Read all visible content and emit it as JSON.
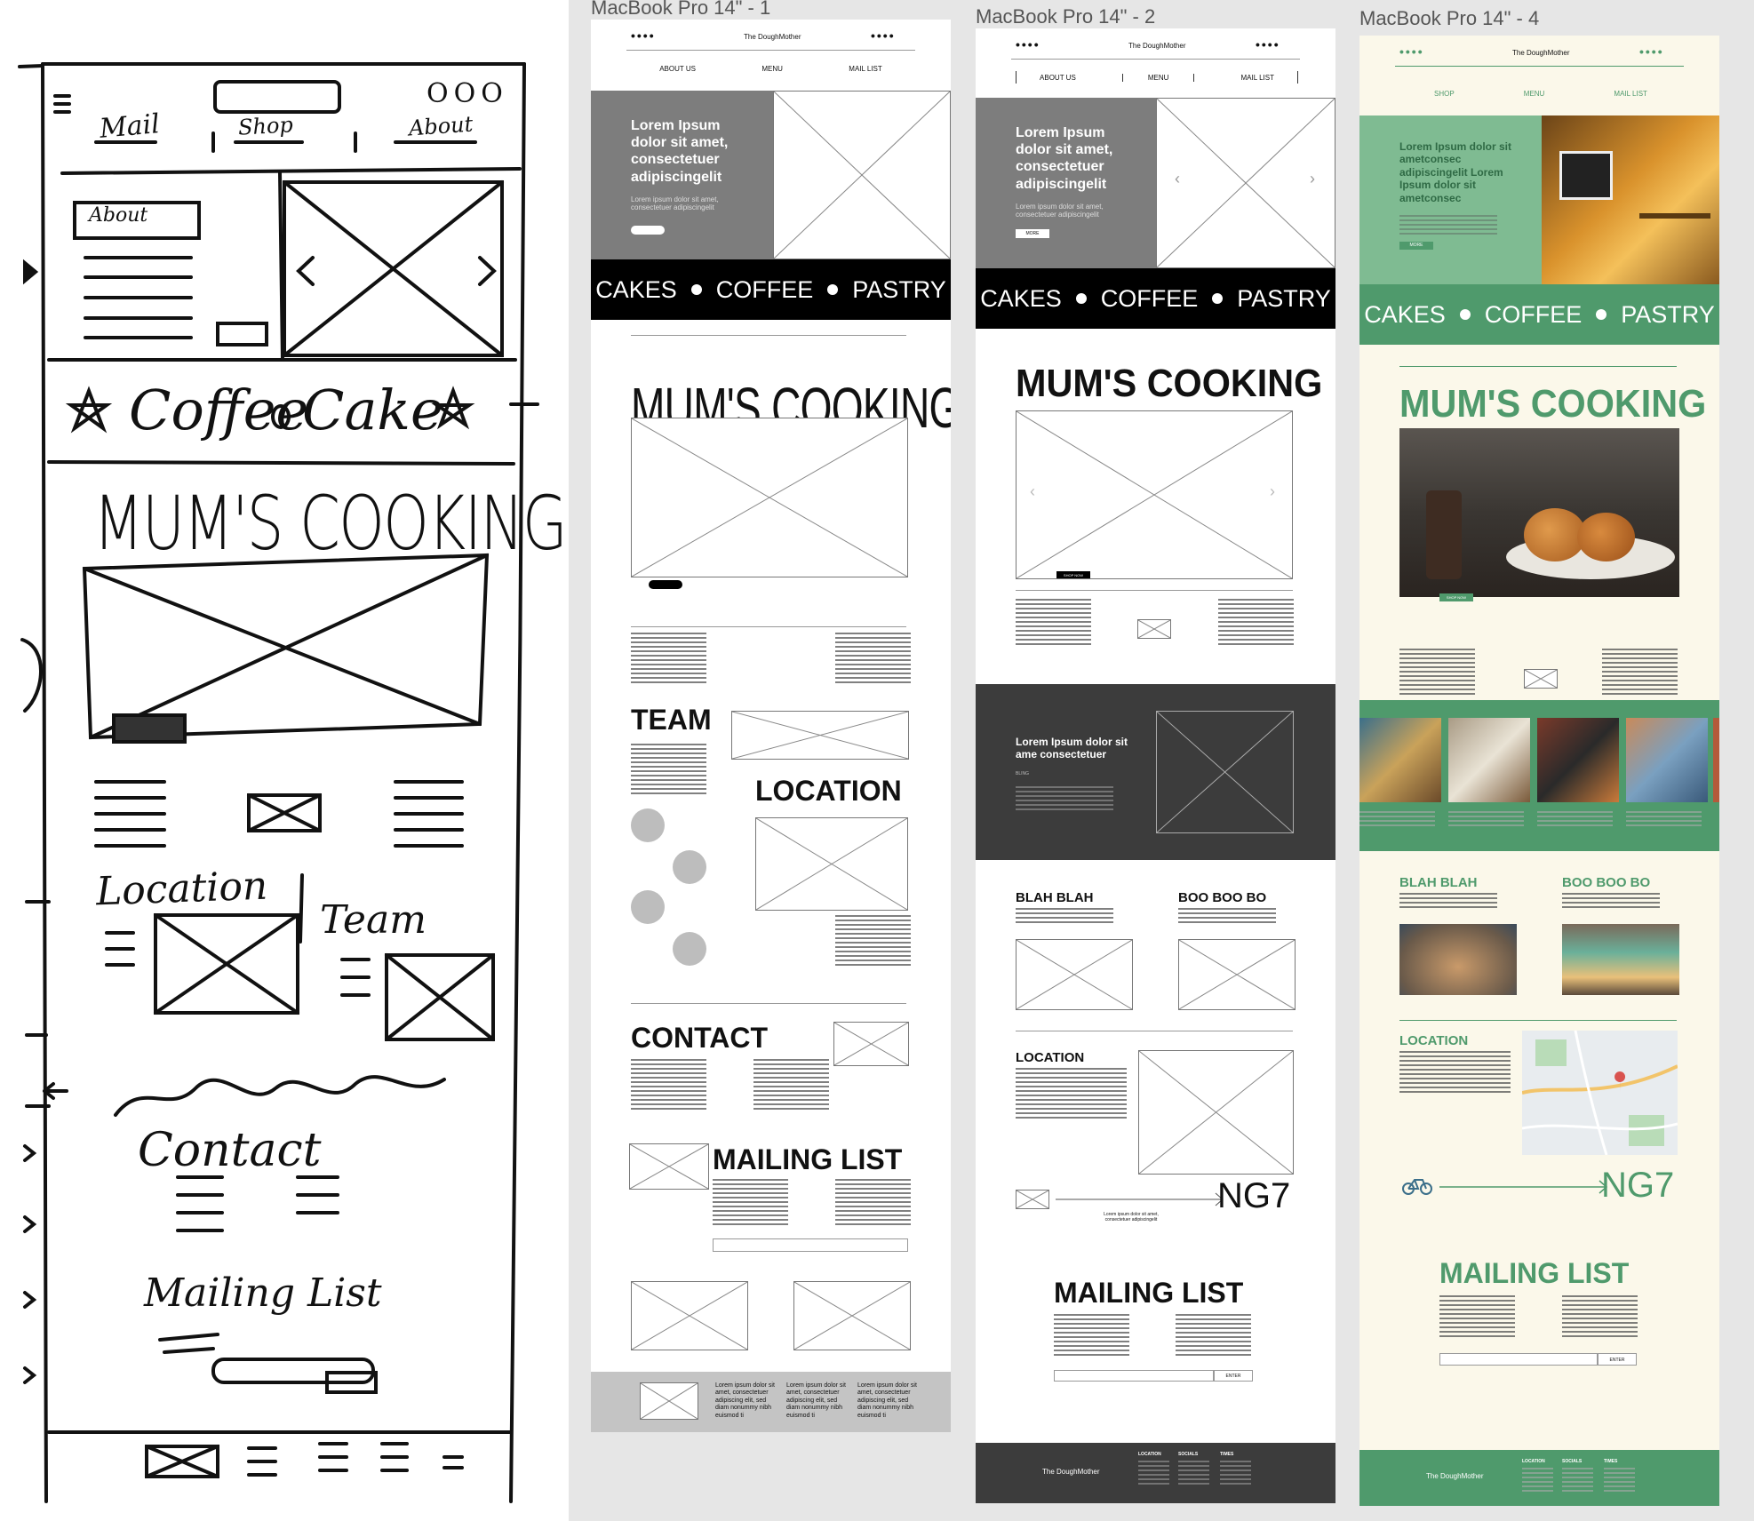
{
  "sketch": {
    "nav": [
      "Mail",
      "Shop",
      "About"
    ],
    "icons": "OOO",
    "about_box": "About",
    "strip": [
      "Coffee",
      "Cake"
    ],
    "heading": "MUM'S COOKING",
    "location": "Location",
    "team": "Team",
    "contact": "Contact",
    "mailing": "Mailing List"
  },
  "frames": {
    "frame1_label": "MacBook Pro 14\" - 1",
    "frame2_label": "MacBook Pro 14\" - 2",
    "frame4_label": "MacBook Pro 14\" - 4"
  },
  "wireframe1": {
    "dots": "••••",
    "brand": "The DoughMother",
    "nav": [
      "ABOUT US",
      "MENU",
      "MAIL LIST"
    ],
    "hero_title": "Lorem Ipsum dolor sit amet, consectetuer adipiscingelit",
    "hero_sub": "Lorem ipsum dolor sit amet, consectetuer adipiscingelit",
    "strip": [
      "CAKES",
      "COFFEE",
      "PASTRY"
    ],
    "heading": "MUM'S COOKING",
    "team": "TEAM",
    "location": "LOCATION",
    "contact": "CONTACT",
    "mailing": "MAILING LIST",
    "footer_text": "Lorem ipsum dolor sit amet, consectetuer adipiscing elit, sed diam nonummy nibh euismod ti"
  },
  "wireframe2": {
    "dots": "••••",
    "brand": "The DoughMother",
    "nav": [
      "ABOUT US",
      "MENU",
      "MAIL LIST"
    ],
    "hero_title": "Lorem Ipsum dolor sit amet, consectetuer adipiscingelit",
    "hero_sub": "Lorem ipsum dolor sit amet, consectetuer adipiscingelit",
    "hero_btn": "MORE",
    "strip": [
      "CAKES",
      "COFFEE",
      "PASTRY"
    ],
    "heading": "MUM'S COOKING",
    "shop_btn": "SHOP NOW",
    "dark_title": "Lorem Ipsum dolor sit ame consectetuer",
    "dark_label": "BLING",
    "blah": "BLAH BLAH",
    "boo": "BOO BOO BO",
    "location": "LOCATION",
    "ng7": "NG7",
    "arrow_caption": "Lorem ipsum dolor sit amet, consectetuer adipiscingelit",
    "mailing": "MAILING LIST",
    "enter": "ENTER",
    "footer_brand": "The DoughMother",
    "footer_cols": [
      "LOCATION",
      "SOCIALS",
      "TIMES"
    ]
  },
  "mockup": {
    "dots": "••••",
    "brand": "The DoughMother",
    "nav": [
      "SHOP",
      "MENU",
      "MAIL LIST"
    ],
    "hero_title": "Lorem Ipsum dolor sit ametconsec adipiscingelit Lorem Ipsum dolor sit ametconsec",
    "hero_btn": "MORE",
    "strip": [
      "CAKES",
      "COFFEE",
      "PASTRY"
    ],
    "heading": "MUM'S COOKING",
    "shop_btn": "SHOP NOW",
    "blah": "BLAH BLAH",
    "boo": "BOO BOO BO",
    "location": "LOCATION",
    "ng7": "NG7",
    "mailing": "MAILING LIST",
    "enter": "ENTER",
    "footer_brand": "The DoughMother",
    "footer_cols": [
      "LOCATION",
      "SOCIALS",
      "TIMES"
    ],
    "colors": {
      "green": "#4f9a6c",
      "cream": "#fbf8ea",
      "dark": "#2f2f2f"
    }
  }
}
